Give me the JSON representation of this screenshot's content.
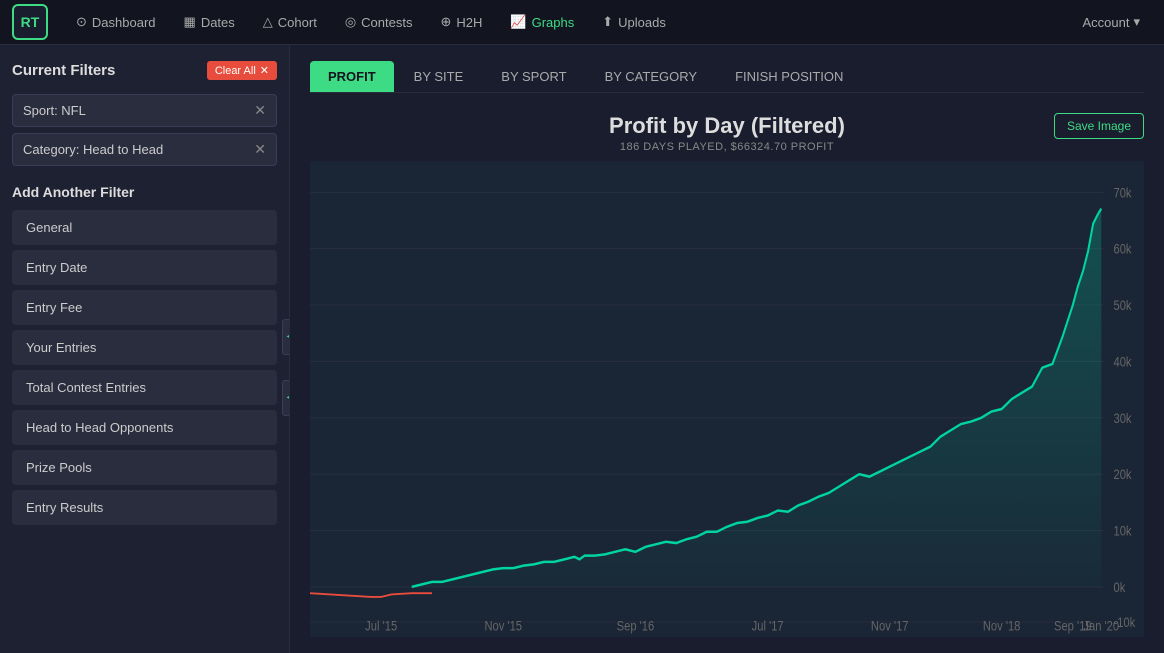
{
  "app": {
    "logo": "RT"
  },
  "navbar": {
    "items": [
      {
        "label": "Dashboard",
        "icon": "⊙",
        "active": false
      },
      {
        "label": "Dates",
        "icon": "📅",
        "active": false
      },
      {
        "label": "Cohort",
        "icon": "△",
        "active": false
      },
      {
        "label": "Contests",
        "icon": "◎",
        "active": false
      },
      {
        "label": "H2H",
        "icon": "⊕",
        "active": false
      },
      {
        "label": "Graphs",
        "icon": "📈",
        "active": true
      },
      {
        "label": "Uploads",
        "icon": "⬆",
        "active": false
      }
    ],
    "account": "Account"
  },
  "sidebar": {
    "title": "Current Filters",
    "clear_all": "Clear All",
    "active_filters": [
      {
        "label": "Sport: NFL"
      },
      {
        "label": "Category: Head to Head"
      }
    ],
    "add_filter_title": "Add Another Filter",
    "filter_buttons": [
      {
        "label": "General"
      },
      {
        "label": "Entry Date"
      },
      {
        "label": "Entry Fee"
      },
      {
        "label": "Your Entries"
      },
      {
        "label": "Total Contest Entries"
      },
      {
        "label": "Head to Head Opponents"
      },
      {
        "label": "Prize Pools"
      },
      {
        "label": "Entry Results"
      }
    ]
  },
  "tabs": [
    {
      "label": "PROFIT",
      "active": true
    },
    {
      "label": "BY SITE",
      "active": false
    },
    {
      "label": "BY SPORT",
      "active": false
    },
    {
      "label": "BY CATEGORY",
      "active": false
    },
    {
      "label": "FINISH POSITION",
      "active": false
    }
  ],
  "chart": {
    "title": "Profit by Day (Filtered)",
    "subtitle": "186 DAYS PLAYED, $66324.70 PROFIT",
    "save_button": "Save Image",
    "y_labels": [
      "70k",
      "60k",
      "50k",
      "40k",
      "30k",
      "20k",
      "10k",
      "0k",
      "-10k"
    ],
    "x_labels": [
      "Jul '15",
      "Nov '15",
      "Sep '16",
      "Jul '17",
      "Nov '17",
      "Nov '18",
      "Sep '19",
      "Jan '20"
    ]
  },
  "colors": {
    "accent": "#3ddc84",
    "active_tab_bg": "#3ddc84",
    "active_tab_text": "#12141f",
    "chart_line": "#00d4a0",
    "chart_negative": "#e74c3c",
    "chart_bg": "#1a2535",
    "grid_line": "#223",
    "clear_btn": "#e74c3c"
  }
}
